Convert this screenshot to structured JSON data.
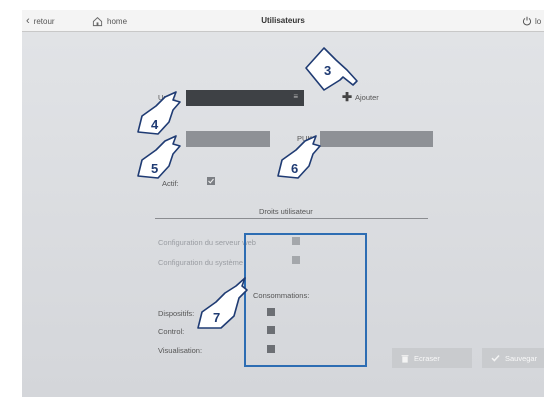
{
  "topbar": {
    "back_label": "retour",
    "home_label": "home",
    "title": "Utilisateurs",
    "logout_label": "lo"
  },
  "form": {
    "user_label": "User:",
    "add_label": "Ajouter",
    "puk_label": "PUK:",
    "active_label": "Actif:",
    "rights_title": "Droits utilisateur",
    "web_config_label": "Configuration du serveur web",
    "system_config_label": "Configuration du système",
    "consumption_title": "Consommations:",
    "devices_label": "Dispositifs:",
    "control_label": "Control:",
    "visualisation_label": "Visualisation:"
  },
  "buttons": {
    "delete_label": "Ecraser",
    "save_label": "Sauvegar"
  },
  "callouts": {
    "c3": "3",
    "c4": "4",
    "c5": "5",
    "c6": "6",
    "c7": "7"
  },
  "colors": {
    "highlight": "#2d6db3",
    "callout_fill": "#ffffff",
    "callout_text": "#1f3b73"
  }
}
